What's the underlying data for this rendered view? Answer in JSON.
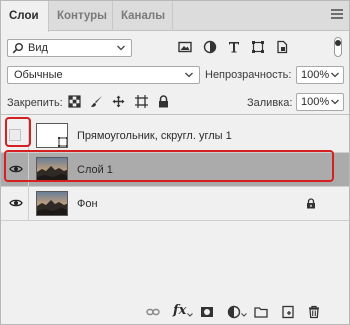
{
  "tabs": [
    {
      "label": "Слои",
      "active": true
    },
    {
      "label": "Контуры",
      "active": false
    },
    {
      "label": "Каналы",
      "active": false
    }
  ],
  "filter": {
    "kind_label": "Вид"
  },
  "blend": {
    "mode": "Обычные",
    "opacity_label": "Непрозрачность:",
    "opacity": "100%"
  },
  "lock": {
    "label": "Закрепить:",
    "fill_label": "Заливка:",
    "fill": "100%"
  },
  "layers": [
    {
      "name": "Прямоугольник, скругл. углы 1",
      "visible": false,
      "selected": false,
      "locked": false,
      "thumb": "shape"
    },
    {
      "name": "Слой 1",
      "visible": true,
      "selected": true,
      "locked": false,
      "thumb": "photo"
    },
    {
      "name": "Фон",
      "visible": true,
      "selected": false,
      "locked": true,
      "thumb": "photo"
    }
  ],
  "colors": {
    "selected_row": "#ababab",
    "highlight": "#d42020"
  },
  "icons": {
    "filter": [
      "image-filter-icon",
      "adjustment-filter-icon",
      "type-filter-icon",
      "shape-filter-icon",
      "smart-object-filter-icon"
    ],
    "lock": [
      "lock-transparent-icon",
      "lock-pixels-icon",
      "lock-position-icon",
      "lock-artboard-icon",
      "lock-all-icon"
    ],
    "bottom": [
      "link-layers-icon",
      "fx-icon",
      "add-mask-icon",
      "new-adjustment-icon",
      "new-group-icon",
      "new-layer-icon",
      "delete-layer-icon"
    ]
  },
  "bottom_fx_label": "fx"
}
